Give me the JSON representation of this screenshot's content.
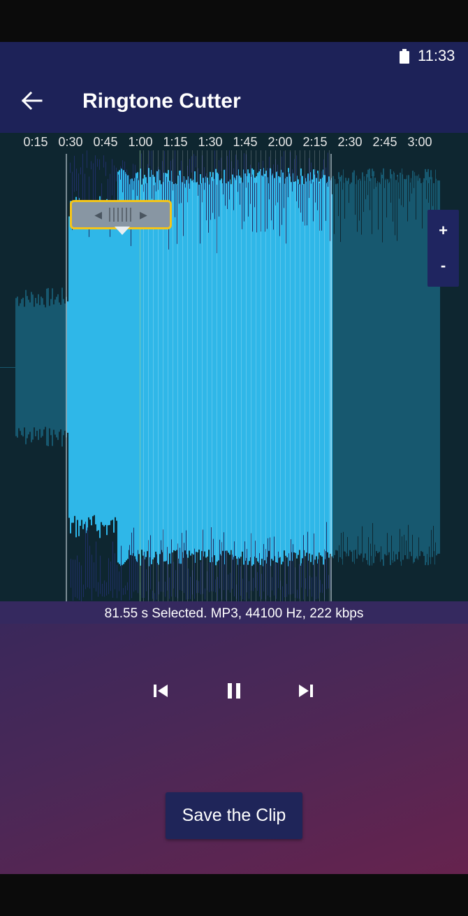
{
  "status_bar": {
    "time": "11:33",
    "battery_icon": "battery-full-icon"
  },
  "app_bar": {
    "title": "Ringtone Cutter",
    "back_icon": "arrow-back-icon"
  },
  "timeline": {
    "ticks": [
      "0:15",
      "0:30",
      "0:45",
      "1:00",
      "1:15",
      "1:30",
      "1:45",
      "2:00",
      "2:15",
      "2:30",
      "2:45",
      "3:00"
    ],
    "selection_start_tick_fraction": 0.87,
    "selection_end_tick_fraction": 8.47,
    "start_handle": {
      "icon_left": "◀",
      "icon_right": "▶",
      "highlighted": true,
      "highlight_color": "#f5c518"
    },
    "end_handle": {
      "icon_left": "◀",
      "icon_right": "▶",
      "highlighted": false
    },
    "zoom_in_label": "+",
    "zoom_out_label": "-",
    "colors": {
      "selected": "#2fb7e8",
      "unselected": "#17586f",
      "background": "#0e2630",
      "spike": "#1f2f66"
    }
  },
  "info": "81.55 s Selected. MP3, 44100 Hz, 222 kbps",
  "controls": {
    "previous_icon": "skip-previous-icon",
    "pause_icon": "pause-icon",
    "next_icon": "skip-next-icon"
  },
  "save_button_label": "Save the Clip",
  "theme": {
    "appbar": "#1d2258",
    "button": "#1f2559"
  }
}
